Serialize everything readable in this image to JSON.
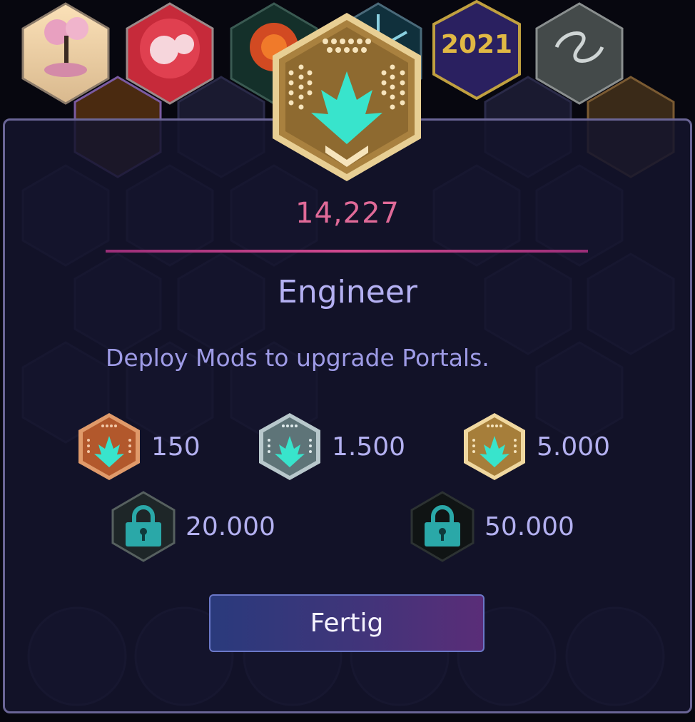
{
  "badge": {
    "name": "Engineer",
    "score": "14,227",
    "description": "Deploy Mods to upgrade Portals.",
    "current_tier": "gold"
  },
  "background": {
    "year_badge_text": "2021"
  },
  "tiers": [
    {
      "id": "bronze",
      "value": "150",
      "locked": false,
      "color": "#c06a3c"
    },
    {
      "id": "silver",
      "value": "1.500",
      "locked": false,
      "color": "#7f9aa0"
    },
    {
      "id": "gold",
      "value": "5.000",
      "locked": false,
      "color": "#c39a56"
    },
    {
      "id": "platinum",
      "value": "20.000",
      "locked": true,
      "color": "#2a9ea0"
    },
    {
      "id": "onyx",
      "value": "50.000",
      "locked": true,
      "color": "#2a9ea0"
    }
  ],
  "actions": {
    "done_label": "Fertig"
  },
  "colors": {
    "score": "#e06a98",
    "title": "#b4b0f2",
    "accent_teal": "#30e0cc",
    "panel_border": "#6a6596"
  }
}
